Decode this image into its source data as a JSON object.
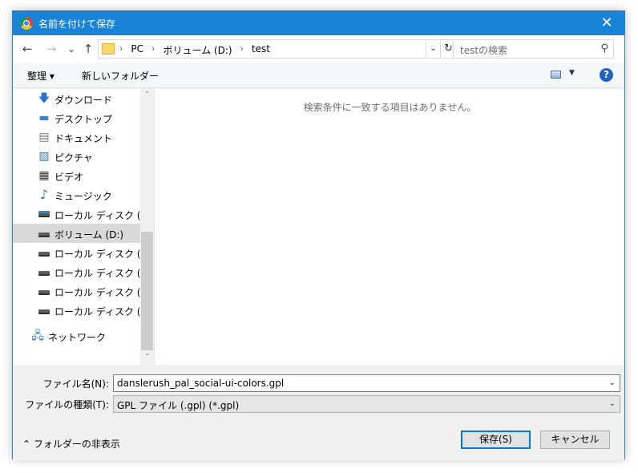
{
  "window": {
    "title": "名前を付けて保存",
    "close_glyph": "✕"
  },
  "nav": {
    "back": "←",
    "forward": "→",
    "recent": "⌄",
    "up": "↑"
  },
  "address": {
    "crumbs": [
      "PC",
      "ボリューム (D:)",
      "test"
    ],
    "separator": "›",
    "dropdown_glyph": "⌄",
    "refresh_glyph": "↻"
  },
  "search": {
    "placeholder": "testの検索",
    "icon_glyph": "⚲"
  },
  "toolbar": {
    "organize": "整理 ▾",
    "new_folder": "新しいフォルダー",
    "view_dropdown": "▼",
    "help": "?"
  },
  "sidebar": {
    "items": [
      {
        "label": "ダウンロード",
        "icon": "download-icon",
        "glyph": "🡇"
      },
      {
        "label": "デスクトップ",
        "icon": "desktop-icon",
        "glyph": "▬"
      },
      {
        "label": "ドキュメント",
        "icon": "document-icon",
        "glyph": "▤"
      },
      {
        "label": "ピクチャ",
        "icon": "pictures-icon",
        "glyph": "▨"
      },
      {
        "label": "ビデオ",
        "icon": "video-icon",
        "glyph": "▦"
      },
      {
        "label": "ミュージック",
        "icon": "music-icon",
        "glyph": "♪"
      },
      {
        "label": "ローカル ディスク (C:)",
        "icon": "windows-drive-icon",
        "glyph": ""
      },
      {
        "label": "ボリューム (D:)",
        "icon": "drive-icon",
        "glyph": "",
        "selected": true
      },
      {
        "label": "ローカル ディスク (E:)",
        "icon": "drive-icon",
        "glyph": ""
      },
      {
        "label": "ローカル ディスク (F:)",
        "icon": "drive-icon",
        "glyph": ""
      },
      {
        "label": "ローカル ディスク (G:)",
        "icon": "drive-icon",
        "glyph": ""
      },
      {
        "label": "ローカル ディスク (H:)",
        "icon": "drive-icon",
        "glyph": ""
      },
      {
        "label": "ネットワーク",
        "icon": "network-icon",
        "glyph": "🖧"
      }
    ],
    "scroll_up": "ˆ",
    "scroll_down": "ˇ"
  },
  "filelist": {
    "empty_message": "検索条件に一致する項目はありません。"
  },
  "form": {
    "filename_label": "ファイル名(N):",
    "filename_value": "danslerush_pal_social-ui-colors.gpl",
    "filetype_label": "ファイルの種類(T):",
    "filetype_value": "GPL ファイル (.gpl) (*.gpl)",
    "combo_arrow": "⌄"
  },
  "footer": {
    "hide_folders": "⌃  フォルダーの非表示",
    "save": "保存(S)",
    "cancel": "キャンセル"
  },
  "colors": {
    "accent": "#1883d7",
    "selected_bg": "#d9d9d9",
    "primary_border": "#0078d7"
  }
}
